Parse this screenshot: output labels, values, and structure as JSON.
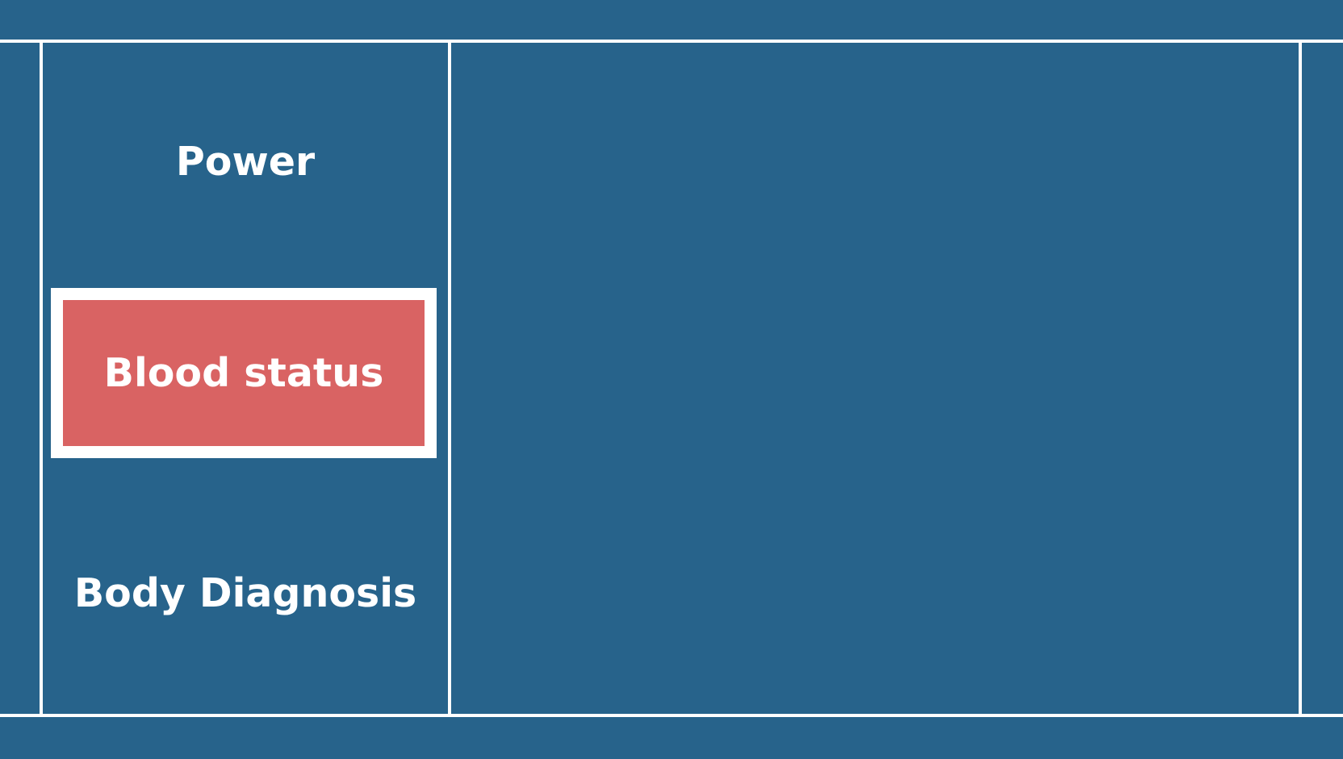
{
  "menu": {
    "items": [
      {
        "label": "Power",
        "selected": false
      },
      {
        "label": "Blood status",
        "selected": true
      },
      {
        "label": "Body Diagnosis",
        "selected": false
      }
    ]
  },
  "colors": {
    "background": "#27638b",
    "selected": "#d96363",
    "lines": "#ffffff",
    "text": "#ffffff"
  }
}
